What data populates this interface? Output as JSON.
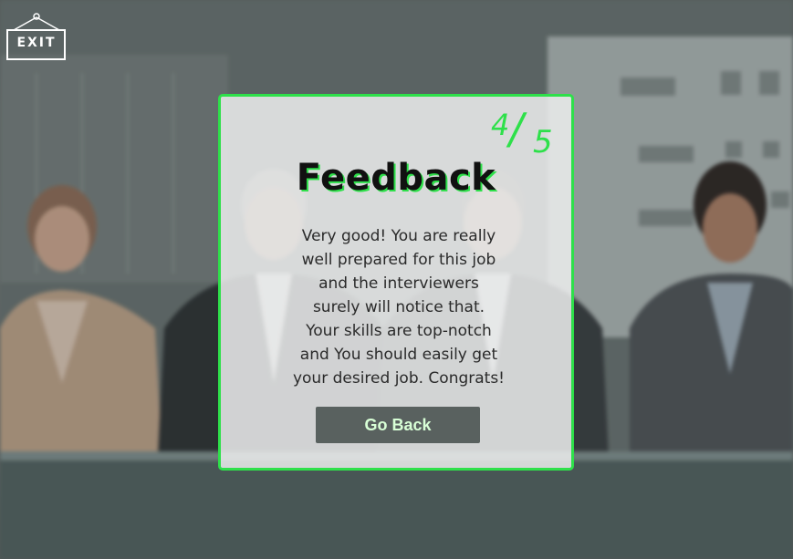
{
  "exit": {
    "label": "EXIT",
    "icon": "exit-sign-icon"
  },
  "feedback": {
    "score_current": "4",
    "score_separator": "/",
    "score_total": "5",
    "title": "Feedback",
    "message_lines": [
      "Very good! You are really",
      "well prepared for this job",
      "and the interviewers",
      "surely will notice that.",
      "Your skills are top-notch",
      "and You should easily get",
      "your desired job. Congrats!"
    ],
    "button_label": "Go Back"
  },
  "colors": {
    "accent": "#2ee04a",
    "button_bg": "#59615f",
    "button_text": "#d8ffd6",
    "card_bg": "#eceeee"
  }
}
